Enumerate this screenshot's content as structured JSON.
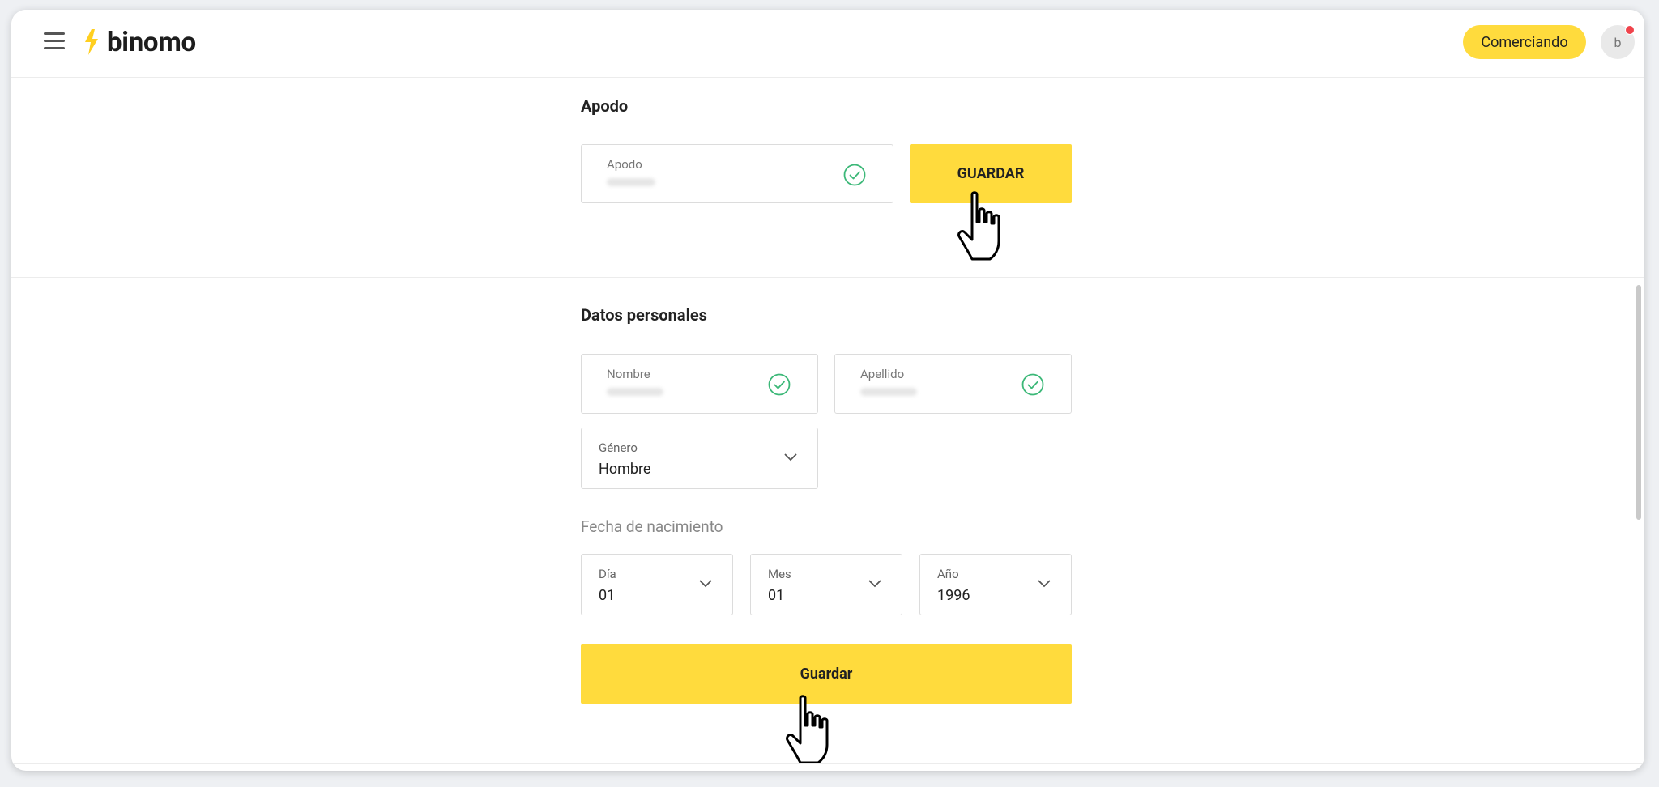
{
  "header": {
    "logo_text": "binomo",
    "trade_button": "Comerciando",
    "avatar_initial": "b"
  },
  "nickname_section": {
    "title": "Apodo",
    "field_label": "Apodo",
    "save_button": "GUARDAR"
  },
  "personal_section": {
    "title": "Datos personales",
    "first_name_label": "Nombre",
    "last_name_label": "Apellido",
    "gender": {
      "label": "Género",
      "value": "Hombre"
    },
    "birth_label": "Fecha de nacimiento",
    "day": {
      "label": "Día",
      "value": "01"
    },
    "month": {
      "label": "Mes",
      "value": "01"
    },
    "year": {
      "label": "Año",
      "value": "1996"
    },
    "save_button": "Guardar"
  },
  "colors": {
    "accent": "#ffdb3d",
    "check": "#3cb878",
    "notification": "#f0434b"
  }
}
